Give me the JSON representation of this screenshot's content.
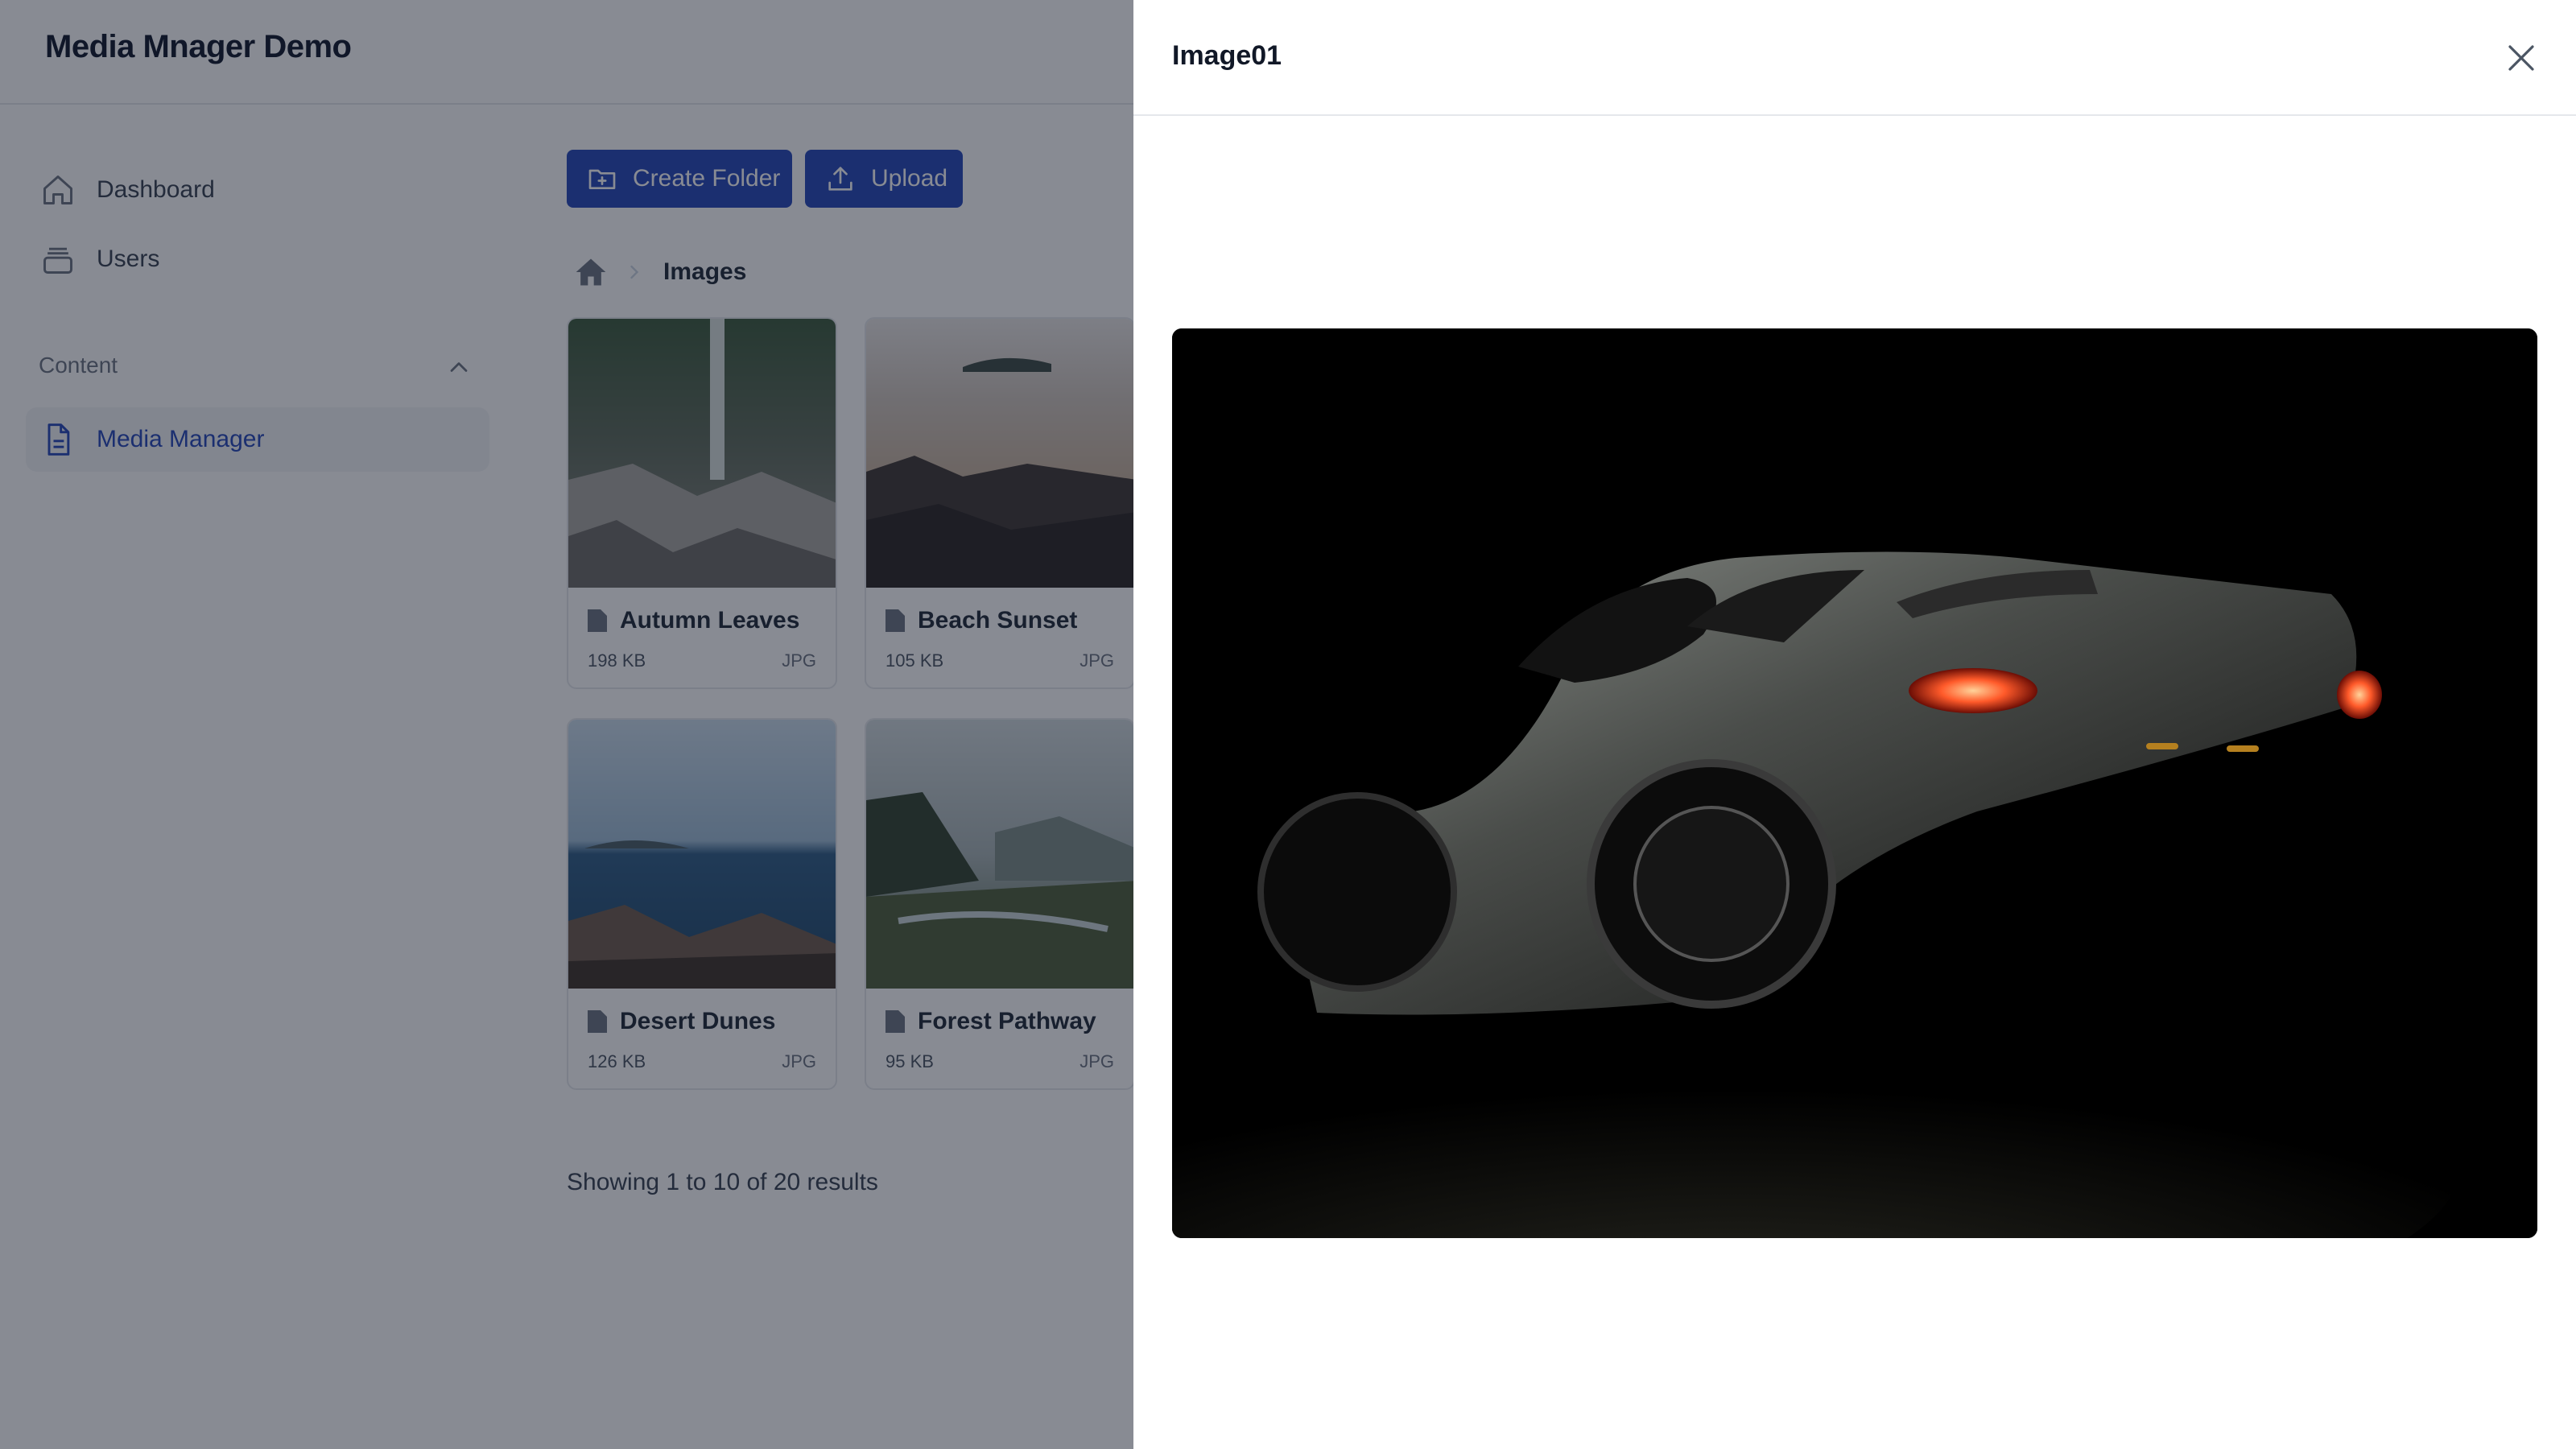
{
  "app": {
    "title": "Media Mnager Demo"
  },
  "sidebar": {
    "items": [
      {
        "label": "Dashboard",
        "icon": "home-icon"
      },
      {
        "label": "Users",
        "icon": "stack-icon"
      }
    ],
    "section": {
      "label": "Content",
      "icon": "chevron-up-icon"
    },
    "section_items": [
      {
        "label": "Media Manager",
        "icon": "document-icon",
        "active": true
      }
    ]
  },
  "toolbar": {
    "create_folder_label": "Create Folder",
    "upload_label": "Upload"
  },
  "breadcrumb": {
    "home_icon": "home-icon",
    "current": "Images"
  },
  "files": [
    {
      "name": "Autumn Leaves",
      "size": "198 KB",
      "ext": "JPG"
    },
    {
      "name": "Beach Sunset",
      "size": "105 KB",
      "ext": "JPG"
    },
    {
      "name": "Desert Dunes",
      "size": "126 KB",
      "ext": "JPG"
    },
    {
      "name": "Forest Pathway",
      "size": "95 KB",
      "ext": "JPG"
    }
  ],
  "pagination": {
    "summary": "Showing 1 to 10 of 20 results"
  },
  "modal": {
    "title": "Image01",
    "close_icon": "close-icon",
    "preview_subject": "sports-car-photo"
  },
  "colors": {
    "accent": "#2446b8",
    "overlay": "#111827"
  }
}
